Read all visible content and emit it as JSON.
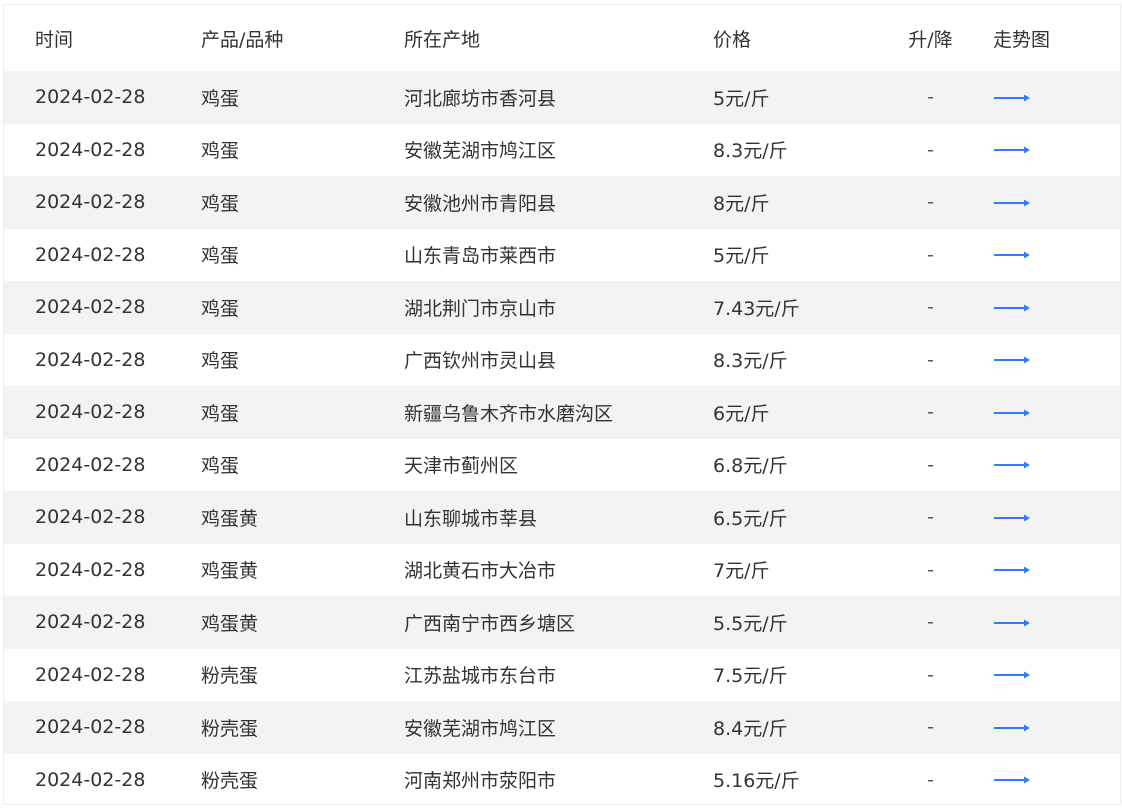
{
  "table": {
    "headers": {
      "time": "时间",
      "product": "产品/品种",
      "origin": "所在产地",
      "price": "价格",
      "change": "升/降",
      "trend": "走势图"
    },
    "rows": [
      {
        "time": "2024-02-28",
        "product": "鸡蛋",
        "origin": "河北廊坊市香河县",
        "price": "5元/斤",
        "change": "-"
      },
      {
        "time": "2024-02-28",
        "product": "鸡蛋",
        "origin": "安徽芜湖市鸠江区",
        "price": "8.3元/斤",
        "change": "-"
      },
      {
        "time": "2024-02-28",
        "product": "鸡蛋",
        "origin": "安徽池州市青阳县",
        "price": "8元/斤",
        "change": "-"
      },
      {
        "time": "2024-02-28",
        "product": "鸡蛋",
        "origin": "山东青岛市莱西市",
        "price": "5元/斤",
        "change": "-"
      },
      {
        "time": "2024-02-28",
        "product": "鸡蛋",
        "origin": "湖北荆门市京山市",
        "price": "7.43元/斤",
        "change": "-"
      },
      {
        "time": "2024-02-28",
        "product": "鸡蛋",
        "origin": "广西钦州市灵山县",
        "price": "8.3元/斤",
        "change": "-"
      },
      {
        "time": "2024-02-28",
        "product": "鸡蛋",
        "origin": "新疆乌鲁木齐市水磨沟区",
        "price": "6元/斤",
        "change": "-"
      },
      {
        "time": "2024-02-28",
        "product": "鸡蛋",
        "origin": "天津市蓟州区",
        "price": "6.8元/斤",
        "change": "-"
      },
      {
        "time": "2024-02-28",
        "product": "鸡蛋黄",
        "origin": "山东聊城市莘县",
        "price": "6.5元/斤",
        "change": "-"
      },
      {
        "time": "2024-02-28",
        "product": "鸡蛋黄",
        "origin": "湖北黄石市大冶市",
        "price": "7元/斤",
        "change": "-"
      },
      {
        "time": "2024-02-28",
        "product": "鸡蛋黄",
        "origin": "广西南宁市西乡塘区",
        "price": "5.5元/斤",
        "change": "-"
      },
      {
        "time": "2024-02-28",
        "product": "粉壳蛋",
        "origin": "江苏盐城市东台市",
        "price": "7.5元/斤",
        "change": "-"
      },
      {
        "time": "2024-02-28",
        "product": "粉壳蛋",
        "origin": "安徽芜湖市鸠江区",
        "price": "8.4元/斤",
        "change": "-"
      },
      {
        "time": "2024-02-28",
        "product": "粉壳蛋",
        "origin": "河南郑州市荥阳市",
        "price": "5.16元/斤",
        "change": "-"
      }
    ]
  },
  "colors": {
    "trend_arrow": "#2f7cf6",
    "row_stripe": "#f3f3f3"
  },
  "icons": {
    "trend": "trend-arrow-icon"
  }
}
